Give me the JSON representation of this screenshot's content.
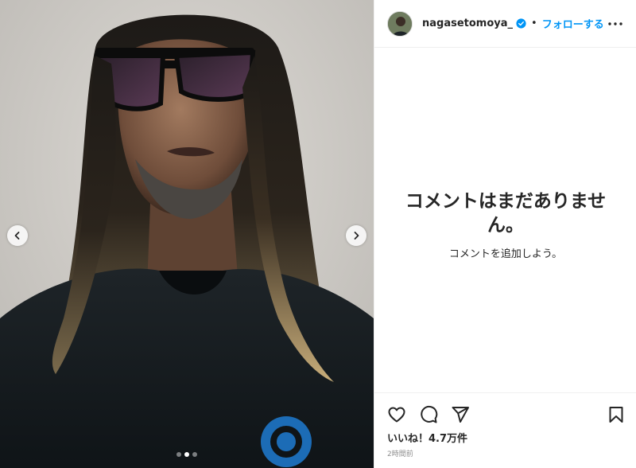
{
  "post": {
    "username": "nagasetomoya_",
    "separator": "•",
    "follow_label": "フォローする",
    "carousel": {
      "count": 3,
      "active_index": 1
    }
  },
  "comments": {
    "empty_title": "コメントはまだありません。",
    "empty_subtitle": "コメントを追加しよう。"
  },
  "footer": {
    "likes_label": "いいね！4.7万件",
    "timestamp": "2時間前"
  },
  "icons": {
    "verified": "verified-badge-icon",
    "more": "more-options-icon",
    "like": "heart-icon",
    "comment": "comment-bubble-icon",
    "share": "paper-plane-icon",
    "save": "bookmark-icon",
    "prev": "chevron-left-icon",
    "next": "chevron-right-icon"
  },
  "colors": {
    "accent": "#0095f6",
    "text": "#262626",
    "muted": "#8e8e8e",
    "border": "#efefef"
  }
}
